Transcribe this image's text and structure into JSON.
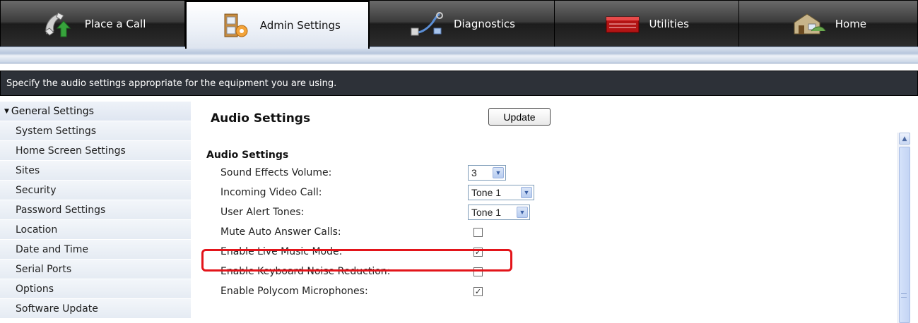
{
  "nav": {
    "tabs": [
      {
        "label": "Place a Call",
        "icon": "phone-call-icon"
      },
      {
        "label": "Admin Settings",
        "icon": "admin-settings-icon"
      },
      {
        "label": "Diagnostics",
        "icon": "diagnostics-icon"
      },
      {
        "label": "Utilities",
        "icon": "utilities-icon"
      },
      {
        "label": "Home",
        "icon": "home-icon"
      }
    ],
    "active_tab": "Admin Settings"
  },
  "instruction": "Specify the audio settings appropriate for the equipment you are using.",
  "sidebar": {
    "header": "General Settings",
    "items": [
      {
        "label": "System Settings"
      },
      {
        "label": "Home Screen Settings"
      },
      {
        "label": "Sites"
      },
      {
        "label": "Security"
      },
      {
        "label": "Password Settings"
      },
      {
        "label": "Location"
      },
      {
        "label": "Date and Time"
      },
      {
        "label": "Serial Ports"
      },
      {
        "label": "Options"
      },
      {
        "label": "Software Update"
      }
    ]
  },
  "main": {
    "title": "Audio Settings",
    "update_label": "Update",
    "section_title": "Audio Settings",
    "settings": [
      {
        "label": "Sound Effects Volume:",
        "type": "select",
        "value": "3"
      },
      {
        "label": "Incoming Video Call:",
        "type": "select",
        "value": "Tone 1"
      },
      {
        "label": "User Alert Tones:",
        "type": "select",
        "value": "Tone 1"
      },
      {
        "label": "Mute Auto Answer Calls:",
        "type": "checkbox",
        "checked": false
      },
      {
        "label": "Enable Live Music Mode:",
        "type": "checkbox",
        "checked": true
      },
      {
        "label": "Enable Keyboard Noise Reduction:",
        "type": "checkbox",
        "checked": false
      },
      {
        "label": "Enable Polycom Microphones:",
        "type": "checkbox",
        "checked": true
      }
    ]
  },
  "colors": {
    "highlight": "#e3141a",
    "instruction_bar": "#2d3138"
  }
}
